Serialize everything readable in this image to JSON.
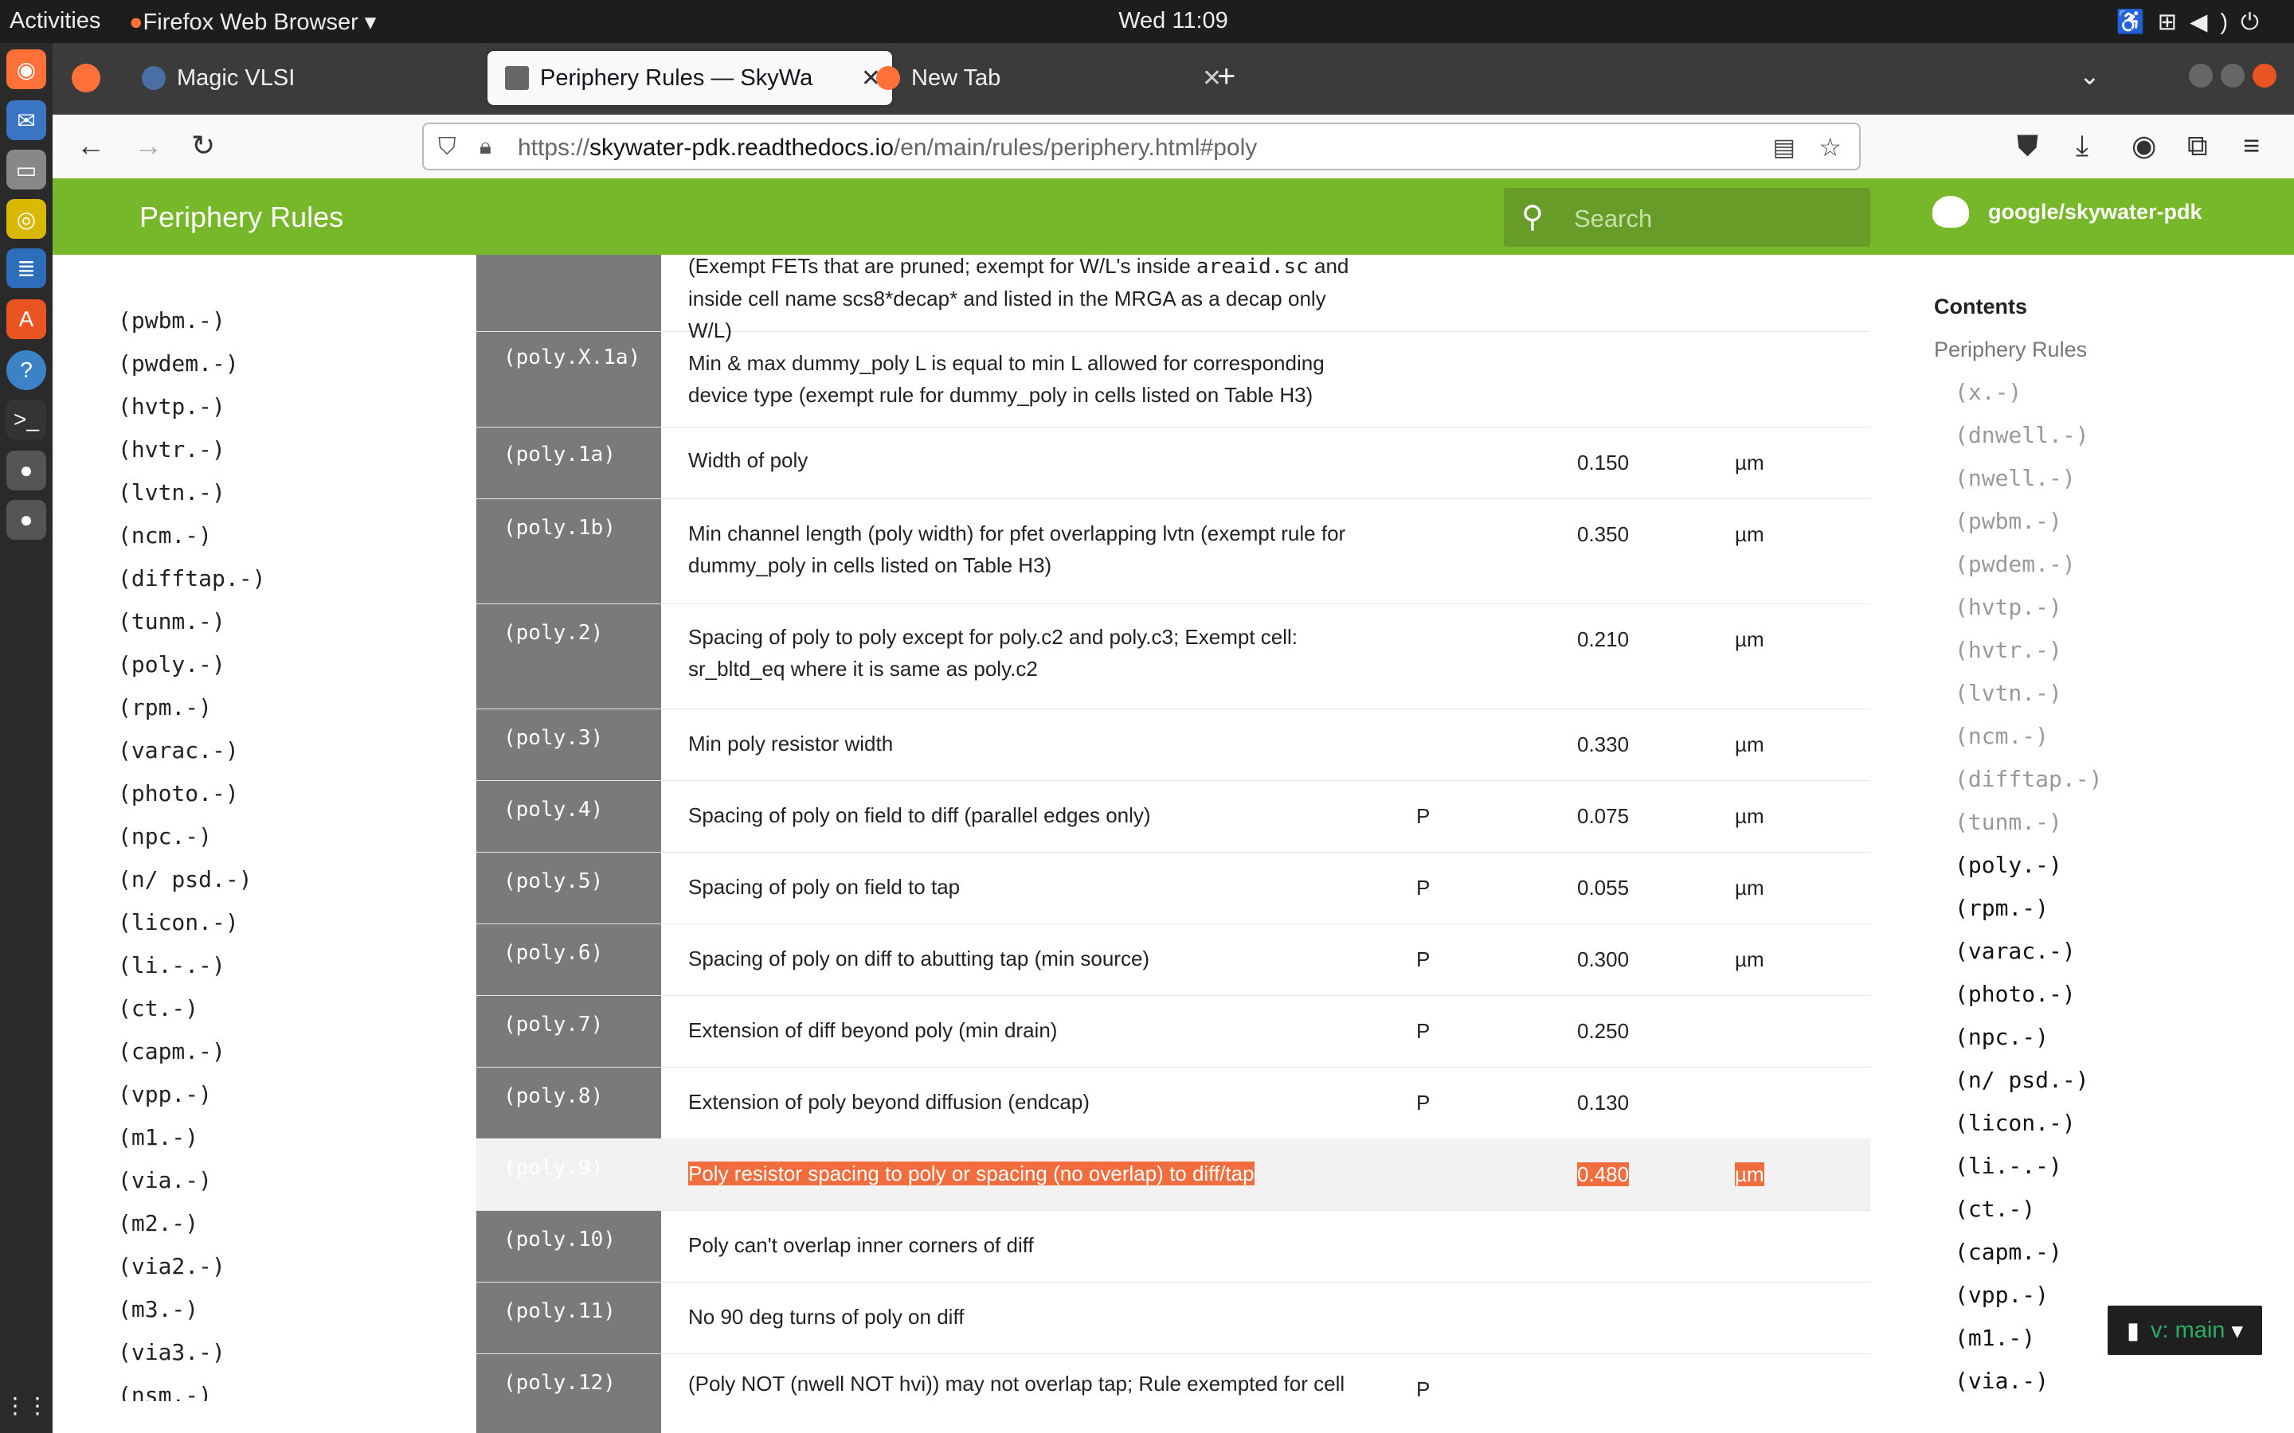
{
  "topbar": {
    "activities": "Activities",
    "app_menu": "Firefox Web Browser",
    "clock": "Wed 11:09"
  },
  "tabs": [
    {
      "label": "Magic VLSI",
      "favicon": "magic-icon"
    },
    {
      "label": "Periphery Rules — SkyWa",
      "favicon": "doc-icon",
      "active": true
    },
    {
      "label": "New Tab",
      "favicon": "firefox-icon"
    }
  ],
  "urlbar": {
    "prefix": "https://",
    "domain": "skywater-pdk.readthedocs.io",
    "path": "/en/main/rules/periphery.html#poly"
  },
  "site": {
    "title": "Periphery Rules",
    "search_placeholder": "Search",
    "repo": "google/skywater-pdk",
    "brand_color": "#76b82a"
  },
  "leftnav": [
    "(pwbm.-)",
    "(pwdem.-)",
    "(hvtp.-)",
    "(hvtr.-)",
    "(lvtn.-)",
    "(ncm.-)",
    "(difftap.-)",
    "(tunm.-)",
    "(poly.-)",
    "(rpm.-)",
    "(varac.-)",
    "(photo.-)",
    "(npc.-)",
    "(n/ psd.-)",
    "(licon.-)",
    "(li.-.-)",
    "(ct.-)",
    "(capm.-)",
    "(vpp.-)",
    "(m1.-)",
    "(via.-)",
    "(m2.-)",
    "(via2.-)",
    "(m3.-)",
    "(via3.-)",
    "(nsm.-)"
  ],
  "rules": [
    {
      "id": "",
      "desc_a": "(Exempt FETs that are pruned; exempt for W/L's inside ",
      "desc_code": "areaid.sc",
      "desc_b": " and inside cell name scs8*decap* and listed in the MRGA as a decap only W/L)",
      "flag": "",
      "value": "",
      "unit": ""
    },
    {
      "id": "(poly.X.1a)",
      "desc": "Min & max dummy_poly L is equal to min L allowed for corresponding device type (exempt rule for dummy_poly in cells listed on Table H3)",
      "flag": "",
      "value": "",
      "unit": ""
    },
    {
      "id": "(poly.1a)",
      "desc": "Width of poly",
      "flag": "",
      "value": "0.150",
      "unit": "µm"
    },
    {
      "id": "(poly.1b)",
      "desc": "Min channel length (poly width) for pfet overlapping lvtn (exempt rule for dummy_poly in cells listed on Table H3)",
      "flag": "",
      "value": "0.350",
      "unit": "µm"
    },
    {
      "id": "(poly.2)",
      "desc": "Spacing of poly to poly except for poly.c2 and poly.c3; Exempt cell: sr_bltd_eq where it is same as poly.c2",
      "flag": "",
      "value": "0.210",
      "unit": "µm"
    },
    {
      "id": "(poly.3)",
      "desc": "Min poly resistor width",
      "flag": "",
      "value": "0.330",
      "unit": "µm"
    },
    {
      "id": "(poly.4)",
      "desc": "Spacing of poly on field to diff (parallel edges only)",
      "flag": "P",
      "value": "0.075",
      "unit": "µm"
    },
    {
      "id": "(poly.5)",
      "desc": "Spacing of poly on field to tap",
      "flag": "P",
      "value": "0.055",
      "unit": "µm"
    },
    {
      "id": "(poly.6)",
      "desc": "Spacing of poly on diff to abutting tap (min source)",
      "flag": "P",
      "value": "0.300",
      "unit": "µm"
    },
    {
      "id": "(poly.7)",
      "desc": "Extension of diff beyond poly (min drain)",
      "flag": "P",
      "value": "0.250",
      "unit": ""
    },
    {
      "id": "(poly.8)",
      "desc": "Extension of poly beyond diffusion (endcap)",
      "flag": "P",
      "value": "0.130",
      "unit": ""
    },
    {
      "id": "(poly.9)",
      "desc": "Poly resistor spacing to poly or spacing (no overlap) to diff/tap",
      "flag": "",
      "value": "0.480",
      "unit": "µm",
      "highlighted": true
    },
    {
      "id": "(poly.10)",
      "desc": "Poly can't overlap inner corners of diff",
      "flag": "",
      "value": "",
      "unit": ""
    },
    {
      "id": "(poly.11)",
      "desc": "No 90 deg turns of poly on diff",
      "flag": "",
      "value": "",
      "unit": ""
    },
    {
      "id": "(poly.12)",
      "desc": "(Poly NOT (nwell NOT hvi)) may not overlap tap; Rule exempted for cell",
      "flag": "P",
      "value": "",
      "unit": ""
    }
  ],
  "toc": {
    "heading": "Contents",
    "root": "Periphery Rules",
    "items_muted": [
      "(x.-)",
      "(dnwell.-)",
      "(nwell.-)",
      "(pwbm.-)",
      "(pwdem.-)",
      "(hvtp.-)",
      "(hvtr.-)",
      "(lvtn.-)",
      "(ncm.-)",
      "(difftap.-)",
      "(tunm.-)"
    ],
    "items": [
      "(poly.-)",
      "(rpm.-)",
      "(varac.-)",
      "(photo.-)",
      "(npc.-)",
      "(n/ psd.-)",
      "(licon.-)",
      "(li.-.-)",
      "(ct.-)",
      "(capm.-)",
      "(vpp.-)",
      "(m1.-)",
      "(via.-)"
    ]
  },
  "version_badge": "v: main"
}
